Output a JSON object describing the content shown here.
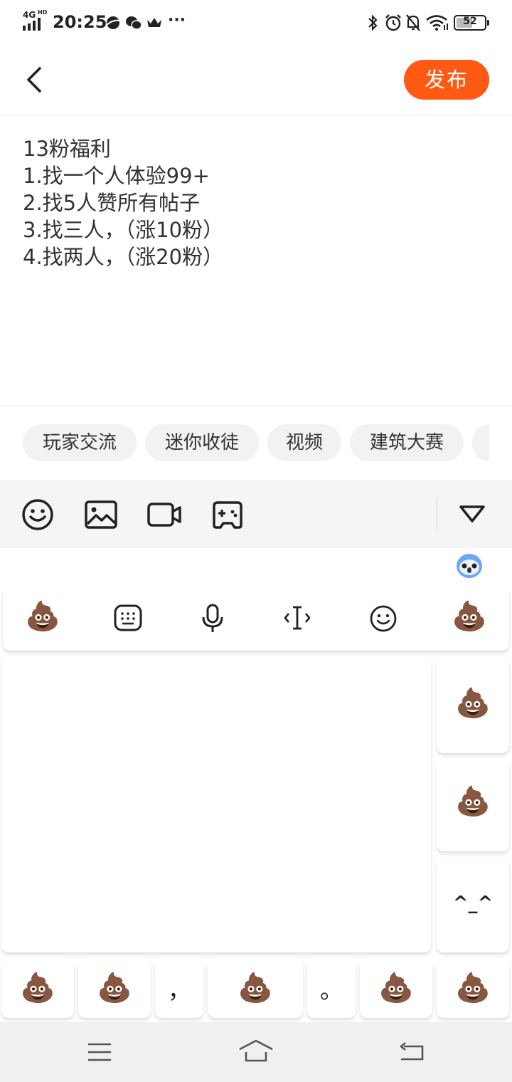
{
  "status_bar": {
    "network": "4G",
    "network_suffix": "HD",
    "time": "20:25",
    "more": "···",
    "battery": "52"
  },
  "post": {
    "lines": [
      "13粉福利",
      "1.找一个人体验99+",
      "2.找5人赞所有帖子",
      "3.找三人，（涨10粉）",
      "4.找两人，（涨20粉）"
    ]
  },
  "header": {
    "publish_label": "发布"
  },
  "tags": [
    "玩家交流",
    "迷你收徒",
    "视频",
    "建筑大赛"
  ],
  "toolbar_icons": [
    "emoji-icon",
    "image-icon",
    "video-icon",
    "gamepad-icon",
    "collapse-icon"
  ],
  "keyboard": {
    "top_row_emoji": "💩",
    "side_keys": [
      "💩",
      "💩",
      "^_^"
    ],
    "bottom_row": [
      "💩",
      "💩",
      "，",
      "💩",
      "。",
      "💩",
      "💩"
    ]
  },
  "colors": {
    "accent": "#ff5a14"
  }
}
